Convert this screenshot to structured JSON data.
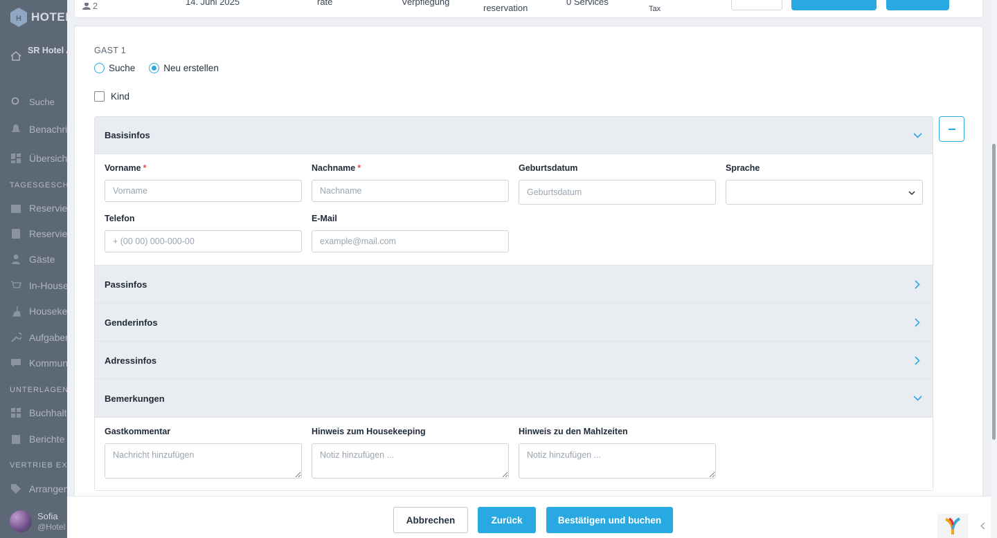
{
  "sidebar": {
    "brand": "HOTEL",
    "hotel_name": "SR Hotel A GA",
    "items": [
      {
        "label": "Suche",
        "icon": "search-icon"
      },
      {
        "label": "Benachrichtigungen",
        "icon": "bell-icon"
      },
      {
        "label": "Übersicht",
        "icon": "dashboard-icon"
      }
    ],
    "sections": [
      {
        "title": "TAGESGESCHÄFT",
        "items": [
          {
            "label": "Reservierungen",
            "icon": "calendar-icon"
          },
          {
            "label": "Reservierungsliste",
            "icon": "document-icon"
          },
          {
            "label": "Gäste",
            "icon": "user-icon"
          },
          {
            "label": "In-House",
            "icon": "cart-icon"
          },
          {
            "label": "Housekeeping",
            "icon": "broom-icon"
          },
          {
            "label": "Aufgaben",
            "icon": "wrench-icon"
          },
          {
            "label": "Kommunikation",
            "icon": "chat-icon"
          }
        ]
      },
      {
        "title": "UNTERLAGEN",
        "items": [
          {
            "label": "Buchhaltung",
            "icon": "grid-icon"
          },
          {
            "label": "Berichte",
            "icon": "clipboard-icon"
          }
        ]
      },
      {
        "title": "VERTRIEB EXTERN",
        "items": [
          {
            "label": "Arrangements",
            "icon": "tag-icon"
          }
        ]
      }
    ],
    "user": {
      "name": "Sofia",
      "handle": "@Hotel"
    }
  },
  "top_row": {
    "guests": "2",
    "date": "14. Juni 2025",
    "rate": "rate",
    "board": "Verpflegung",
    "type": "reservation",
    "services": "0 Services",
    "tax": "Tax"
  },
  "guest": {
    "label": "GAST 1",
    "mode_search": "Suche",
    "mode_new": "Neu erstellen",
    "child_label": "Kind"
  },
  "sections": {
    "basic": "Basisinfos",
    "passport": "Passinfos",
    "gender": "Genderinfos",
    "address": "Adressinfos",
    "remarks": "Bemerkungen"
  },
  "basic": {
    "firstname_label": "Vorname",
    "firstname_placeholder": "Vorname",
    "lastname_label": "Nachname",
    "lastname_placeholder": "Nachname",
    "birthdate_label": "Geburtsdatum",
    "birthdate_placeholder": "Geburtsdatum",
    "language_label": "Sprache",
    "language_value": "",
    "phone_label": "Telefon",
    "phone_placeholder": "+ (00 00) 000-000-00",
    "email_label": "E-Mail",
    "email_placeholder": "example@mail.com",
    "required_mark": "*"
  },
  "remarks": {
    "guest_comment_label": "Gastkommentar",
    "guest_comment_placeholder": "Nachricht hinzufügen",
    "housekeeping_label": "Hinweis zum Housekeeping",
    "housekeeping_placeholder": "Notiz hinzufügen ...",
    "meals_label": "Hinweis zu den Mahlzeiten",
    "meals_placeholder": "Notiz hinzufügen ..."
  },
  "footer": {
    "cancel": "Abbrechen",
    "back": "Zurück",
    "confirm": "Bestätigen und buchen"
  },
  "colors": {
    "accent": "#29a9e1",
    "required": "#e5484d",
    "section_bg": "#e9ecf1"
  }
}
